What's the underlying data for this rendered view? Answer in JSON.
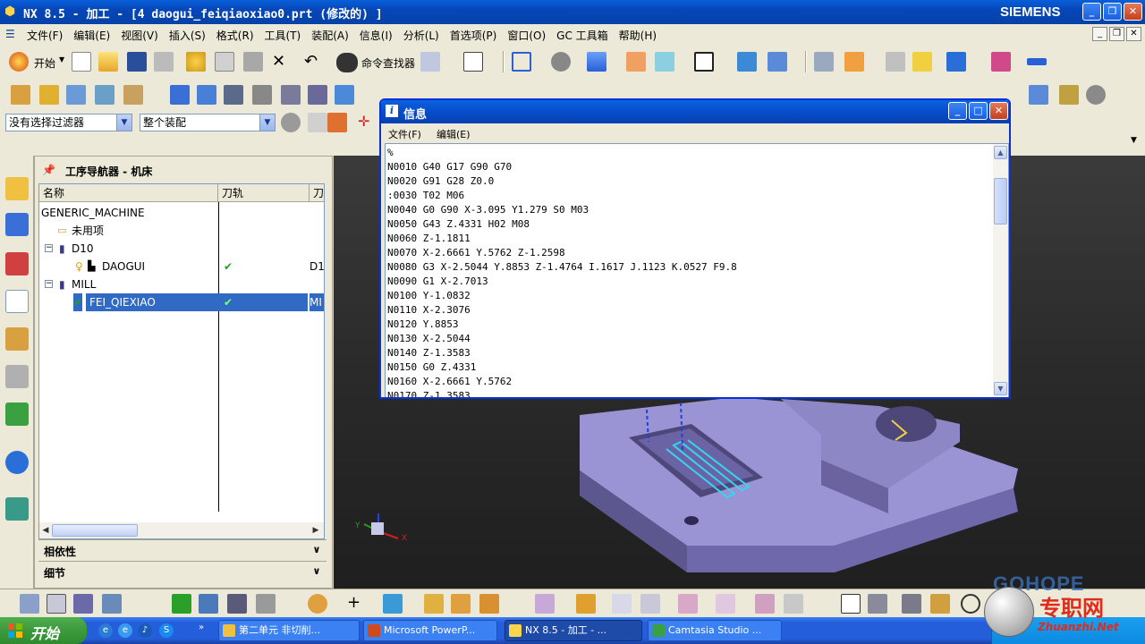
{
  "window": {
    "title": "NX 8.5 - 加工 - [4 daogui_feiqiaoxiao0.prt  (修改的) ]",
    "brand": "SIEMENS"
  },
  "menubar": {
    "items": [
      "文件(F)",
      "编辑(E)",
      "视图(V)",
      "插入(S)",
      "格式(R)",
      "工具(T)",
      "装配(A)",
      "信息(I)",
      "分析(L)",
      "首选项(P)",
      "窗口(O)",
      "GC 工具箱",
      "帮助(H)"
    ]
  },
  "toolbar": {
    "start_label": "开始",
    "command_finder_label": "命令查找器",
    "selection_filter": "没有选择过滤器",
    "assembly_scope": "整个装配"
  },
  "navigator": {
    "title": "工序导航器 - 机床",
    "columns": [
      "名称",
      "刀轨",
      "刀"
    ],
    "rows": [
      {
        "name": "GENERIC_MACHINE",
        "path": "",
        "tool": ""
      },
      {
        "name": "未用项",
        "path": "",
        "tool": ""
      },
      {
        "name": "D10",
        "path": "",
        "tool": ""
      },
      {
        "name": "DAOGUI",
        "path": "✔",
        "tool": "D1"
      },
      {
        "name": "MILL",
        "path": "",
        "tool": ""
      },
      {
        "name": "FEI_QIEXIAO",
        "path": "✔",
        "tool": "MI"
      }
    ],
    "sections": [
      "相依性",
      "细节"
    ]
  },
  "info_dialog": {
    "title": "信息",
    "menu": [
      "文件(F)",
      "编辑(E)"
    ],
    "lines": [
      "%",
      "N0010 G40 G17 G90 G70",
      "N0020 G91 G28 Z0.0",
      ":0030 T02 M06",
      "N0040 G0 G90 X-3.095 Y1.279 S0 M03",
      "N0050 G43 Z.4331 H02 M08",
      "N0060 Z-1.1811",
      "N0070 X-2.6661 Y.5762 Z-1.2598",
      "N0080 G3 X-2.5044 Y.8853 Z-1.4764 I.1617 J.1123 K.0527 F9.8",
      "N0090 G1 X-2.7013",
      "N0100 Y-1.0832",
      "N0110 X-2.3076",
      "N0120 Y.8853",
      "N0130 X-2.5044",
      "N0140 Z-1.3583",
      "N0150 G0 Z.4331",
      "N0160 X-2.6661 Y.5762",
      "N0170 Z-1.3583"
    ]
  },
  "taskbar": {
    "start": "开始",
    "tasks": [
      "第二单元 非切削...",
      "Microsoft PowerP...",
      "NX 8.5 - 加工 - ...",
      "Camtasia Studio ..."
    ]
  },
  "watermark": {
    "brand": "GOHOPE",
    "cn": "专职网",
    "url": "Zhuanzhi.Net"
  },
  "colors": {
    "titlebar": "#0a5fd8",
    "selection": "#316ac5",
    "part": "#8b84c4",
    "toolpath": "#35d6f0"
  }
}
